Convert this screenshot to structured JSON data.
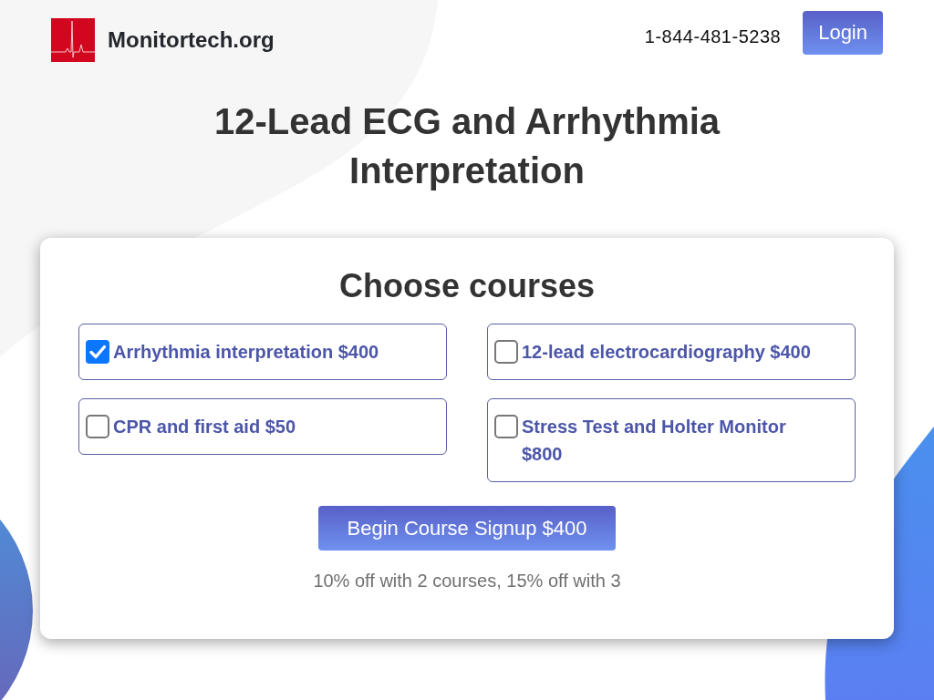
{
  "header": {
    "site_name": "Monitortech.org",
    "phone": "1-844-481-5238",
    "login_button": "Login"
  },
  "title": "12-Lead ECG and Arrhythmia Interpretation",
  "card": {
    "heading": "Choose courses",
    "courses": [
      {
        "label": "Arrhythmia interpretation $400",
        "checked": true
      },
      {
        "label": "12-lead electrocardiography $400",
        "checked": false
      },
      {
        "label": "CPR and first aid $50",
        "checked": false
      },
      {
        "label": "Stress Test and Holter Monitor $800",
        "checked": false
      }
    ],
    "signup_button": "Begin Course Signup $400",
    "discount_note": "10% off with 2 courses, 15% off with 3"
  }
}
